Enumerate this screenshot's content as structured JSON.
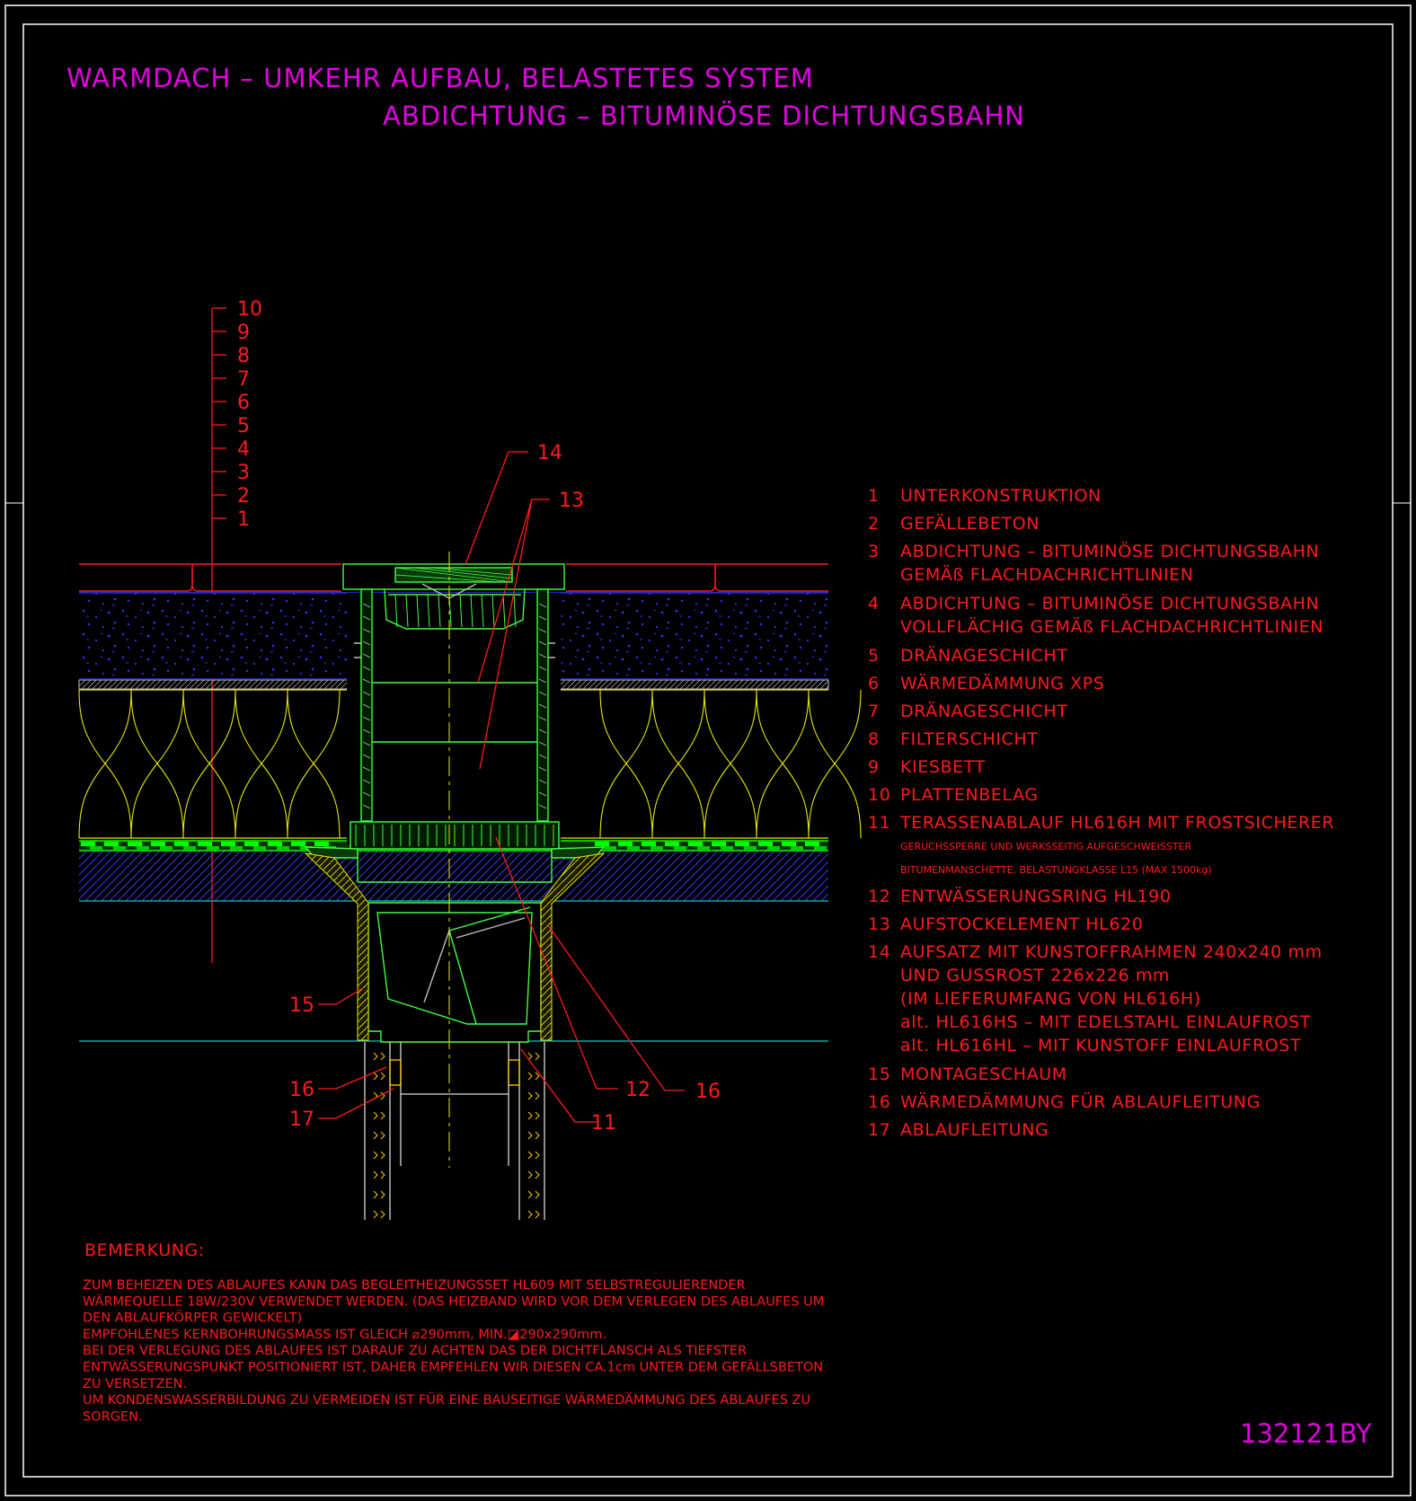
{
  "header": {
    "title_line1": "WARMDACH – UMKEHR AUFBAU, BELASTETES SYSTEM",
    "title_line2": "ABDICHTUNG – BITUMINÖSE DICHTUNGSBAHN"
  },
  "layer_scale": [
    "10",
    "9",
    "8",
    "7",
    "6",
    "5",
    "4",
    "3",
    "2",
    "1"
  ],
  "legend": [
    {
      "num": "1",
      "lines": [
        "UNTERKONSTRUKTION"
      ]
    },
    {
      "num": "2",
      "lines": [
        "GEFÄLLEBETON"
      ]
    },
    {
      "num": "3",
      "lines": [
        "ABDICHTUNG – BITUMINÖSE DICHTUNGSBAHN",
        "GEMÄß FLACHDACHRICHTLINIEN"
      ]
    },
    {
      "num": "4",
      "lines": [
        "ABDICHTUNG – BITUMINÖSE DICHTUNGSBAHN",
        "VOLLFLÄCHIG GEMÄß FLACHDACHRICHTLINIEN"
      ]
    },
    {
      "num": "5",
      "lines": [
        "DRÄNAGESCHICHT"
      ]
    },
    {
      "num": "6",
      "lines": [
        "WÄRMEDÄMMUNG XPS"
      ]
    },
    {
      "num": "7",
      "lines": [
        "DRÄNAGESCHICHT"
      ]
    },
    {
      "num": "8",
      "lines": [
        "FILTERSCHICHT"
      ]
    },
    {
      "num": "9",
      "lines": [
        "KIESBETT"
      ]
    },
    {
      "num": "10",
      "lines": [
        "PLATTENBELAG"
      ]
    },
    {
      "num": "11",
      "lines": [
        "TERASSENABLAUF HL616H MIT FROSTSICHERER"
      ],
      "small_lines": [
        "GERUCHSSPERRE UND WERKSSEITIG AUFGESCHWEISSTER",
        "BITUMENMANSCHETTE, BELASTUNGKLASSE L15 (MAX 1500kg)"
      ]
    },
    {
      "num": "12",
      "lines": [
        "ENTWÄSSERUNGSRING HL190"
      ]
    },
    {
      "num": "13",
      "lines": [
        "AUFSTOCKELEMENT HL620"
      ]
    },
    {
      "num": "14",
      "lines": [
        "AUFSATZ MIT KUNSTOFFRAHMEN 240x240 mm",
        "UND GUSSROST 226x226 mm",
        "(IM LIEFERUMFANG VON HL616H)",
        "alt. HL616HS – MIT EDELSTAHL EINLAUFROST",
        "alt. HL616HL – MIT KUNSTOFF EINLAUFROST"
      ]
    },
    {
      "num": "15",
      "lines": [
        "MONTAGESCHAUM"
      ]
    },
    {
      "num": "16",
      "lines": [
        "WÄRMEDÄMMUNG FÜR ABLAUFLEITUNG"
      ]
    },
    {
      "num": "17",
      "lines": [
        "ABLAUFLEITUNG"
      ]
    }
  ],
  "callouts": {
    "c14": "14",
    "c13": "13",
    "c15": "15",
    "c16a": "16",
    "c17": "17",
    "c12": "12",
    "c16b": "16",
    "c11": "11"
  },
  "remarks": {
    "heading": "BEMERKUNG:",
    "lines": [
      "ZUM BEHEIZEN DES ABLAUFES KANN DAS BEGLEITHEIZUNGSSET HL609 MIT SELBSTREGULIERENDER",
      "WÄRMEQUELLE 18W/230V VERWENDET WERDEN. (DAS HEIZBAND WIRD VOR DEM VERLEGEN DES ABLAUFES UM",
      "DEN ABLAUFKÖRPER GEWICKELT)",
      "EMPFOHLENES KERNBOHRUNGSMASS IST GLEICH ⌀290mm, MIN.◪290x290mm.",
      "BEI DER VERLEGUNG DES ABLAUFES IST DARAUF ZU ACHTEN DAS DER DICHTFLANSCH ALS TIEFSTER",
      "ENTWÄSSERUNGSPUNKT POSITIONIERT IST, DAHER EMPFEHLEN WIR DIESEN CA.1cm UNTER DEM GEFÄLLSBETON",
      "ZU VERSETZEN.",
      "UM KONDENSWASSERBILDUNG ZU VERMEIDEN IST FÜR EINE BAUSEITIGE WÄRMEDÄMMUNG DES ABLAUFES ZU",
      "SORGEN."
    ]
  },
  "drawing_number": "132121BY",
  "colors": {
    "background": "#000000",
    "frame": "#ffffff",
    "title": "#e000e0",
    "text": "#ff1a1a",
    "insulation": "#e8e800",
    "gravel": "#3030ff",
    "membrane": "#00ff00",
    "pipe": "#d8d8d8",
    "cyan": "#00c8c8",
    "green_outline": "#40ff40"
  }
}
